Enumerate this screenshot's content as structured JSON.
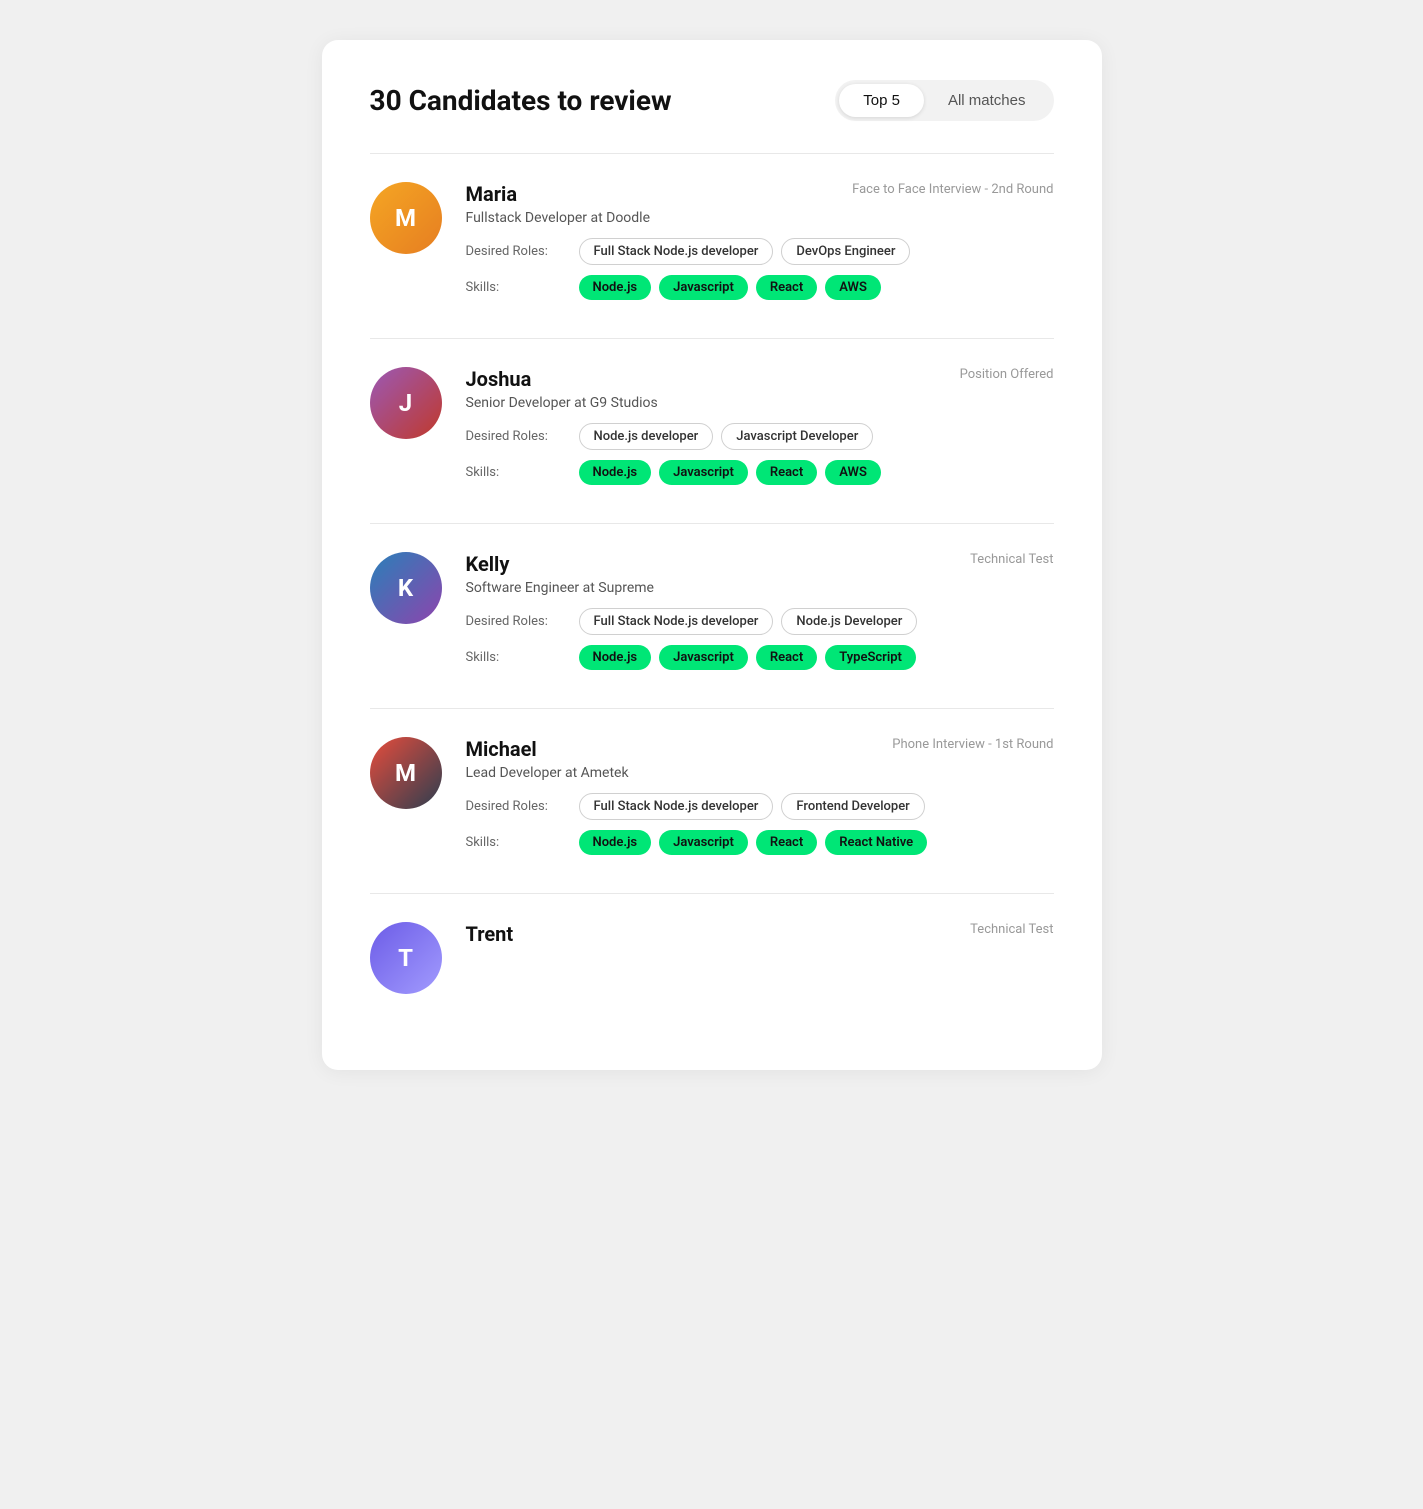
{
  "header": {
    "title": "30 Candidates to review",
    "toggle": {
      "top_label": "Top 5",
      "all_label": "All matches",
      "active": "top"
    }
  },
  "candidates": [
    {
      "id": "maria",
      "name": "Maria",
      "role": "Fullstack Developer at Doodle",
      "stage": "Face to Face Interview - 2nd Round",
      "desired_roles": [
        "Full Stack Node.js developer",
        "DevOps Engineer"
      ],
      "skills": [
        "Node.js",
        "Javascript",
        "React",
        "AWS"
      ],
      "avatar_color": "maria"
    },
    {
      "id": "joshua",
      "name": "Joshua",
      "role": "Senior Developer at G9 Studios",
      "stage": "Position Offered",
      "desired_roles": [
        "Node.js developer",
        "Javascript Developer"
      ],
      "skills": [
        "Node.js",
        "Javascript",
        "React",
        "AWS"
      ],
      "avatar_color": "joshua"
    },
    {
      "id": "kelly",
      "name": "Kelly",
      "role": "Software Engineer at Supreme",
      "stage": "Technical Test",
      "desired_roles": [
        "Full Stack Node.js developer",
        "Node.js Developer"
      ],
      "skills": [
        "Node.js",
        "Javascript",
        "React",
        "TypeScript"
      ],
      "avatar_color": "kelly"
    },
    {
      "id": "michael",
      "name": "Michael",
      "role": "Lead Developer at Ametek",
      "stage": "Phone Interview - 1st Round",
      "desired_roles": [
        "Full Stack Node.js developer",
        "Frontend Developer"
      ],
      "skills": [
        "Node.js",
        "Javascript",
        "React",
        "React Native"
      ],
      "avatar_color": "michael"
    },
    {
      "id": "trent",
      "name": "Trent",
      "role": "",
      "stage": "Technical Test",
      "desired_roles": [],
      "skills": [],
      "avatar_color": "trent"
    }
  ],
  "labels": {
    "desired_roles": "Desired Roles:",
    "skills": "Skills:"
  }
}
